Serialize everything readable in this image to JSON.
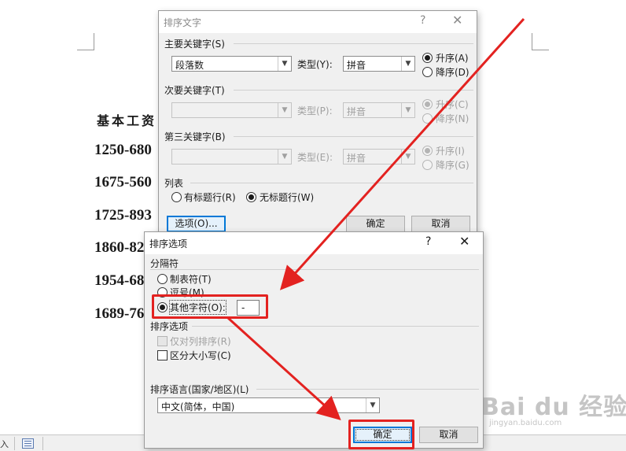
{
  "document": {
    "heading": "基本工资",
    "lines": [
      "1250-680",
      "1675-560",
      "1725-893",
      "1860-82",
      "1954-68",
      "1689-76"
    ]
  },
  "statusbar": {
    "text": "入"
  },
  "sort_dialog": {
    "title": "排序文字",
    "help": "?",
    "close": "✕",
    "primary_key": {
      "label": "主要关键字(S)",
      "field_value": "段落数",
      "type_label": "类型(Y):",
      "type_value": "拼音",
      "ascending": "升序(A)",
      "descending": "降序(D)"
    },
    "secondary_key": {
      "label": "次要关键字(T)",
      "field_value": "",
      "type_label": "类型(P):",
      "type_value": "拼音",
      "ascending": "升序(C)",
      "descending": "降序(N)"
    },
    "tertiary_key": {
      "label": "第三关键字(B)",
      "field_value": "",
      "type_label": "类型(E):",
      "type_value": "拼音",
      "ascending": "升序(I)",
      "descending": "降序(G)"
    },
    "list": {
      "label": "列表",
      "has_header": "有标题行(R)",
      "no_header": "无标题行(W)"
    },
    "options_button": "选项(O)...",
    "ok_button": "确定",
    "cancel_button": "取消"
  },
  "options_dialog": {
    "title": "排序选项",
    "help": "?",
    "close": "✕",
    "separator": {
      "label": "分隔符",
      "tab": "制表符(T)",
      "comma": "逗号(M)",
      "other": "其他字符(O):",
      "other_value": "-"
    },
    "sort_options": {
      "label": "排序选项",
      "column_only": "仅对列排序(R)",
      "case_sensitive": "区分大小写(C)"
    },
    "language": {
      "label": "排序语言(国家/地区)(L)",
      "value": "中文(简体，中国)"
    },
    "ok_button": "确定",
    "cancel_button": "取消"
  },
  "watermark": {
    "logo": "Bai  du 经验",
    "url": "jingyan.baidu.com"
  },
  "colors": {
    "annotation": "#e32220",
    "focus_blue": "#0078d7",
    "dialog_bg": "#f0f0f0"
  }
}
